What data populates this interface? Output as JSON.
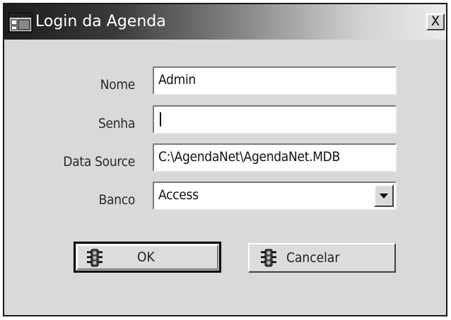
{
  "window": {
    "title": "Login da Agenda",
    "close_label": "X"
  },
  "form": {
    "nome": {
      "label": "Nome",
      "value": "Admin"
    },
    "senha": {
      "label": "Senha",
      "value": ""
    },
    "data_source": {
      "label": "Data Source",
      "value": "C:\\AgendaNet\\AgendaNet.MDB"
    },
    "banco": {
      "label": "Banco",
      "value": "Access"
    }
  },
  "buttons": {
    "ok_label": "OK",
    "cancel_label": "Cancelar"
  },
  "icons": {
    "app": "window-app-icon",
    "ok": "traffic-light-icon",
    "cancel": "traffic-light-icon"
  }
}
